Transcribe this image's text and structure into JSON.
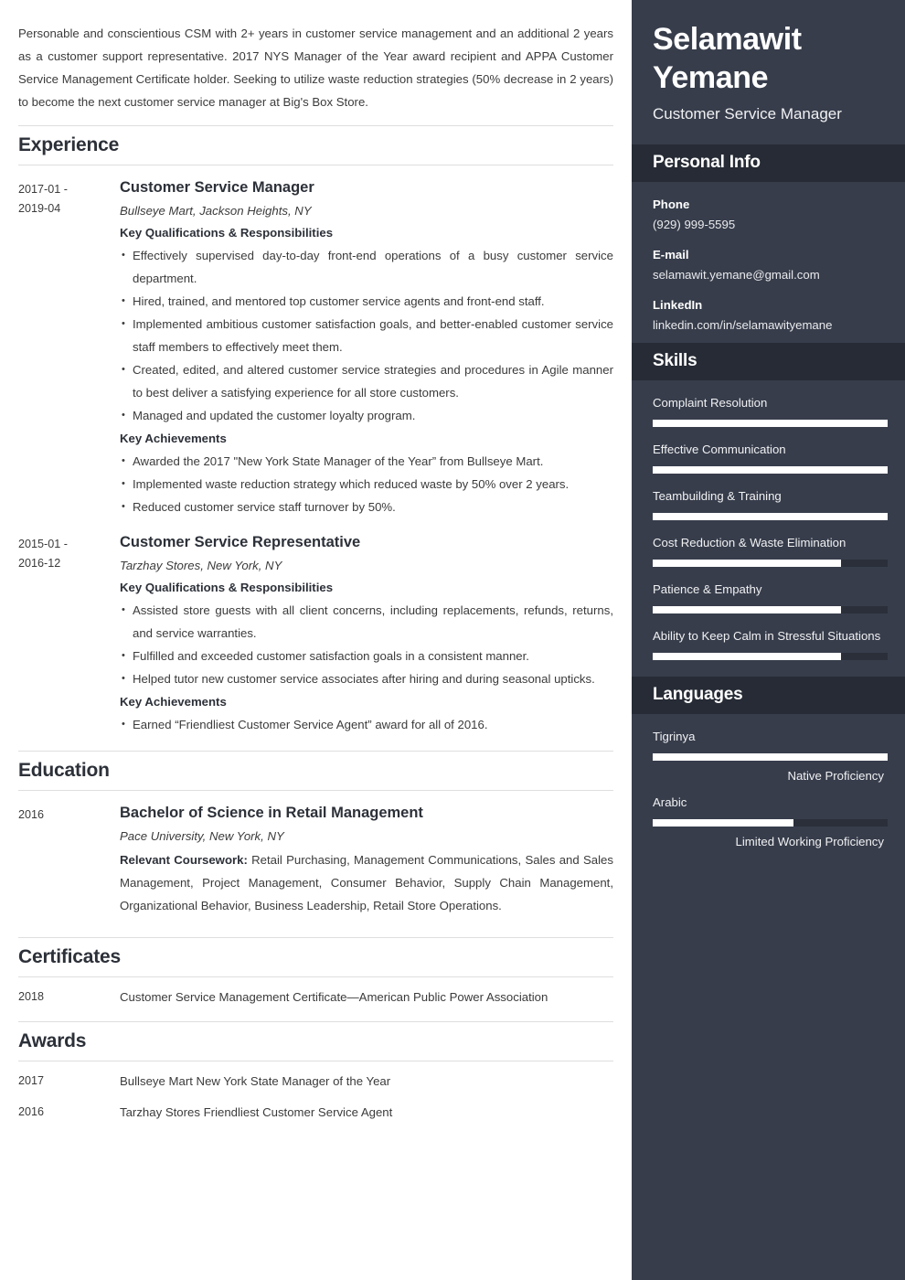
{
  "summary": "Personable and conscientious CSM with 2+ years in customer service management and an additional 2 years as a customer support representative. 2017 NYS Manager of the Year award recipient and APPA Customer Service Management Certificate holder. Seeking to utilize waste reduction strategies (50% decrease in 2 years) to become the next customer service manager at Big's Box Store.",
  "sections": {
    "experience_title": "Experience",
    "education_title": "Education",
    "certificates_title": "Certificates",
    "awards_title": "Awards"
  },
  "experience": [
    {
      "date": "2017-01 - 2019-04",
      "date_line1": "2017-01 -",
      "date_line2": "2019-04",
      "title": "Customer Service Manager",
      "company": "Bullseye Mart, Jackson Heights, NY",
      "responsibilities_label": "Key Qualifications & Responsibilities",
      "responsibilities": [
        "Effectively supervised day-to-day front-end operations of a busy customer service department.",
        "Hired, trained, and mentored top customer service agents and front-end staff.",
        "Implemented ambitious customer satisfaction goals, and better-enabled customer service staff members to effectively meet them.",
        "Created, edited, and altered customer service strategies and procedures in Agile manner to best deliver a satisfying experience for all store customers.",
        "Managed and updated the customer loyalty program."
      ],
      "achievements_label": "Key Achievements",
      "achievements": [
        "Awarded the 2017 \"New York State Manager of the Year” from Bullseye Mart.",
        "Implemented waste reduction strategy which reduced waste by 50% over 2 years.",
        "Reduced customer service staff turnover by 50%."
      ]
    },
    {
      "date": "2015-01 - 2016-12",
      "date_line1": "2015-01 -",
      "date_line2": "2016-12",
      "title": "Customer Service Representative",
      "company": "Tarzhay Stores, New York, NY",
      "responsibilities_label": "Key Qualifications & Responsibilities",
      "responsibilities": [
        "Assisted store guests with all client concerns, including replacements, refunds, returns, and service warranties.",
        "Fulfilled and exceeded customer satisfaction goals in a consistent manner.",
        "Helped tutor new customer service associates after hiring and during seasonal upticks."
      ],
      "achievements_label": "Key Achievements",
      "achievements": [
        "Earned “Friendliest Customer Service Agent” award for all of 2016."
      ]
    }
  ],
  "education": [
    {
      "date": "2016",
      "degree": "Bachelor of Science in Retail Management",
      "school": "Pace University, New York, NY",
      "coursework_label": "Relevant Coursework:",
      "coursework": " Retail Purchasing, Management Communications, Sales and Sales Management, Project Management, Consumer Behavior, Supply Chain Management, Organizational Behavior, Business Leadership, Retail Store Operations."
    }
  ],
  "certificates": [
    {
      "date": "2018",
      "text": "Customer Service Management Certificate—American Public Power Association"
    }
  ],
  "awards": [
    {
      "date": "2017",
      "text": "Bullseye Mart New York State Manager of the Year"
    },
    {
      "date": "2016",
      "text": "Tarzhay Stores Friendliest Customer Service Agent"
    }
  ],
  "sidebar": {
    "name_line1": "Selamawit",
    "name_line2": "Yemane",
    "role": "Customer Service Manager",
    "personal_info_title": "Personal Info",
    "personal_info": [
      {
        "label": "Phone",
        "value": "(929) 999-5595"
      },
      {
        "label": "E-mail",
        "value": "selamawit.yemane@gmail.com"
      },
      {
        "label": "LinkedIn",
        "value": "linkedin.com/in/selamawityemane"
      }
    ],
    "skills_title": "Skills",
    "skills": [
      {
        "name": "Complaint Resolution",
        "level": 100
      },
      {
        "name": "Effective Communication",
        "level": 100
      },
      {
        "name": "Teambuilding & Training",
        "level": 100
      },
      {
        "name": "Cost Reduction & Waste Elimination",
        "level": 80
      },
      {
        "name": "Patience & Empathy",
        "level": 80
      },
      {
        "name": "Ability to Keep Calm in Stressful Situations",
        "level": 80
      }
    ],
    "languages_title": "Languages",
    "languages": [
      {
        "name": "Tigrinya",
        "level": 100,
        "proficiency": "Native Proficiency"
      },
      {
        "name": "Arabic",
        "level": 60,
        "proficiency": "Limited Working Proficiency"
      }
    ]
  },
  "colors": {
    "sidebar_bg": "#373d4b",
    "sidebar_header_bg": "#262b35",
    "bar_track": "#2a2f3a",
    "bar_fill": "#ffffff",
    "heading_text": "#2c3038",
    "body_text": "#3b3b3b",
    "rule": "#dedede"
  }
}
